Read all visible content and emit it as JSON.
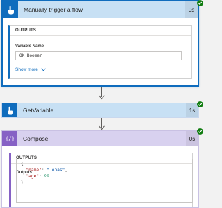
{
  "step_trigger": {
    "title": "Manually trigger a flow",
    "duration": "0s",
    "outputs_label": "OUTPUTS",
    "field_label": "Variable Name",
    "field_value": "OK Boomer",
    "show_more": "Show more"
  },
  "step_getvariable": {
    "title": "GetVariable",
    "duration": "1s"
  },
  "step_compose": {
    "title": "Compose",
    "duration": "0s",
    "outputs_label": "OUTPUTS",
    "field_label": "Outputs",
    "json_open": "{",
    "json_close": "}",
    "json_lines": [
      {
        "key": "\"name\"",
        "sep": ": ",
        "value": "\"Jonas\"",
        "trail": ",",
        "kind": "str"
      },
      {
        "key": "\"age\"",
        "sep": ": ",
        "value": "99",
        "trail": "",
        "kind": "num"
      }
    ]
  },
  "colors": {
    "trigger_accent": "#0f6cbd",
    "compose_accent": "#8661c5",
    "success": "#107c10"
  },
  "icons": [
    "hand-pointer-icon",
    "hand-pointer-icon",
    "code-braces-icon",
    "check-icon",
    "chevron-down-icon",
    "arrow-down-icon"
  ]
}
